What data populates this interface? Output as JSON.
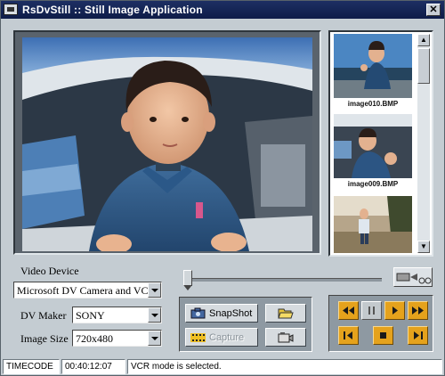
{
  "window": {
    "title": "RsDvStill :: Still Image Application",
    "close_label": "✕"
  },
  "thumbnails": [
    {
      "filename": "image010.BMP"
    },
    {
      "filename": "image009.BMP"
    },
    {
      "filename": ""
    }
  ],
  "controls": {
    "video_device": {
      "label": "Video Device",
      "value": "Microsoft DV Camera and VCR"
    },
    "dv_maker": {
      "label": "DV Maker",
      "value": "SONY"
    },
    "image_size": {
      "label": "Image Size",
      "value": "720x480"
    },
    "snapshot_label": "SnapShot",
    "capture_label": "Capture",
    "capture_enabled": false
  },
  "status": {
    "timecode_label": "TIMECODE",
    "timecode_value": "00:40:12:07",
    "message": "VCR mode is selected."
  },
  "colors": {
    "titlebar": "#0e1c48",
    "transport_active": "#e5a21c",
    "panel": "#c4ccd2"
  }
}
